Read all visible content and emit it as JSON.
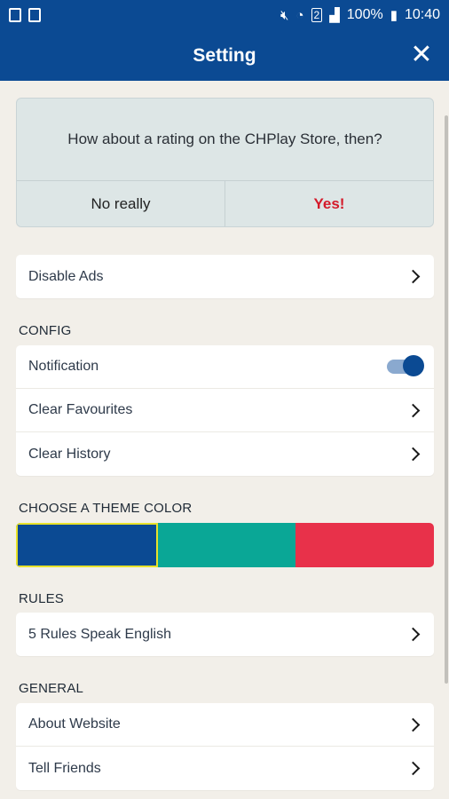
{
  "status_bar": {
    "battery": "100%",
    "time": "10:40",
    "sim_badge": "2"
  },
  "app_bar": {
    "title": "Setting",
    "close_icon": "close-icon"
  },
  "rating_card": {
    "question": "How about a rating on the CHPlay Store, then?",
    "no_label": "No really",
    "yes_label": "Yes!"
  },
  "ads": {
    "label": "Disable Ads"
  },
  "config": {
    "header": "CONFIG",
    "items": [
      {
        "label": "Notification",
        "control": "toggle",
        "on": true
      },
      {
        "label": "Clear Favourites",
        "control": "chevron"
      },
      {
        "label": "Clear History",
        "control": "chevron"
      }
    ]
  },
  "theme": {
    "header": "CHOOSE A THEME COLOR",
    "colors": [
      "#0b4a93",
      "#0aa796",
      "#e8314a"
    ],
    "selected_index": 0
  },
  "rules": {
    "header": "RULES",
    "items": [
      {
        "label": "5 Rules Speak English"
      }
    ]
  },
  "general": {
    "header": "GENERAL",
    "items": [
      {
        "label": "About Website"
      },
      {
        "label": "Tell Friends"
      }
    ]
  },
  "colors": {
    "primary": "#0b4a93",
    "background": "#f2efe9",
    "accent_yes": "#d41a2a"
  }
}
